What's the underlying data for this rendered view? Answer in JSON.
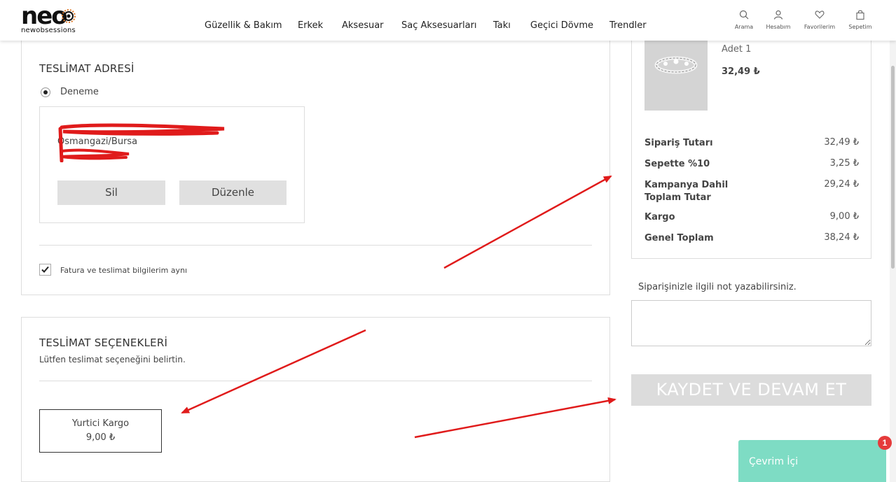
{
  "brand": {
    "name": "neo",
    "tagline": "newobsessions",
    "accent": "#e07b2a"
  },
  "nav": {
    "items": [
      "Güzellik & Bakım",
      "Erkek",
      "Aksesuar",
      "Saç Aksesuarları",
      "Takı",
      "Geçici Dövme",
      "Trendler"
    ]
  },
  "header_icons": [
    {
      "label": "Arama",
      "icon": "search-icon"
    },
    {
      "label": "Hesabım",
      "icon": "user-icon"
    },
    {
      "label": "Favorilerim",
      "icon": "heart-icon"
    },
    {
      "label": "Sepetim",
      "icon": "bag-icon"
    }
  ],
  "address": {
    "title": "TESLİMAT ADRESİ",
    "option_name": "Deneme",
    "city_line": "Osmangazi/Bursa",
    "delete_label": "Sil",
    "edit_label": "Düzenle",
    "same_billing_label": "Fatura ve teslimat bilgilerim aynı",
    "same_billing_checked": true
  },
  "shipping": {
    "title": "TESLİMAT SEÇENEKLERİ",
    "subtitle": "Lütfen teslimat seçeneğini belirtin.",
    "option_name": "Yurtici Kargo",
    "option_price": "9,00 ₺"
  },
  "cart": {
    "quantity": "Adet 1",
    "price": "32,49 ₺"
  },
  "summary": [
    {
      "label": "Sipariş Tutarı",
      "value": "32,49 ₺"
    },
    {
      "label": "Sepette %10",
      "value": "3,25 ₺"
    },
    {
      "label": "Kampanya Dahil Toplam Tutar",
      "value": "29,24 ₺"
    },
    {
      "label": "Kargo",
      "value": "9,00 ₺"
    },
    {
      "label": "Genel Toplam",
      "value": "38,24 ₺"
    }
  ],
  "note": {
    "label": "Siparişinizle ilgili not yazabilirsiniz.",
    "value": ""
  },
  "save_button": "KAYDET VE DEVAM ET",
  "chat": {
    "label": "Çevrim İçi",
    "badge": "1",
    "color": "#7edcc4"
  },
  "annotation_color": "#e01b1b"
}
